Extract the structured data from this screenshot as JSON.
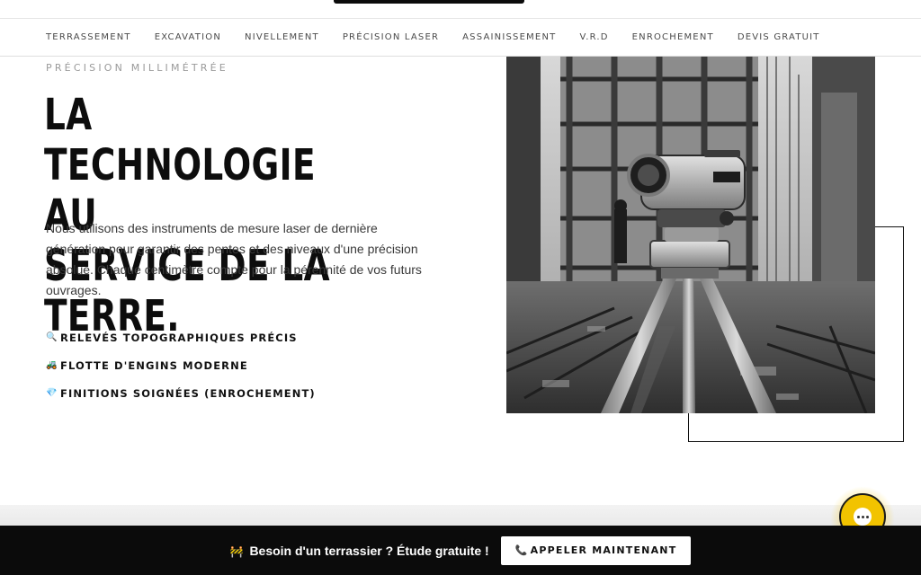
{
  "nav": {
    "items": [
      {
        "label": "TERRASSEMENT"
      },
      {
        "label": "EXCAVATION"
      },
      {
        "label": "NIVELLEMENT"
      },
      {
        "label": "PRÉCISION LASER"
      },
      {
        "label": "ASSAINISSEMENT"
      },
      {
        "label": "V.R.D"
      },
      {
        "label": "ENROCHEMENT"
      },
      {
        "label": "DEVIS GRATUIT"
      }
    ]
  },
  "hero": {
    "eyebrow": "PRÉCISION MILLIMÉTRÉE",
    "headline_line1": "LA TECHNOLOGIE AU",
    "headline_line2": "SERVICE DE LA TERRE.",
    "description": "Nous utilisons des instruments de mesure laser de dernière génération pour garantir des pentes et des niveaux d'une précision absolue. Chaque centimètre compte pour la pérennité de vos futurs ouvrages.",
    "features": [
      {
        "icon": "🔍",
        "icon_name": "magnifier-icon",
        "label": "RELEVÉS TOPOGRAPHIQUES PRÉCIS"
      },
      {
        "icon": "🚜",
        "icon_name": "tractor-icon",
        "label": "FLOTTE D'ENGINS MODERNE"
      },
      {
        "icon": "💎",
        "icon_name": "gem-icon",
        "label": "FINITIONS SOIGNÉES (ENROCHEMENT)"
      }
    ],
    "image": {
      "subject": "laser level on tripod at construction site",
      "tone": "black-and-white"
    }
  },
  "chat": {
    "icon_name": "chat-bubble-icon",
    "color": "#f2c300"
  },
  "cta_bar": {
    "icon": "🚧",
    "text": "Besoin d'un terrassier ? Étude gratuite !",
    "button_icon": "📞",
    "button_label": "APPELER MAINTENANT",
    "background": "#0b0b0b"
  }
}
